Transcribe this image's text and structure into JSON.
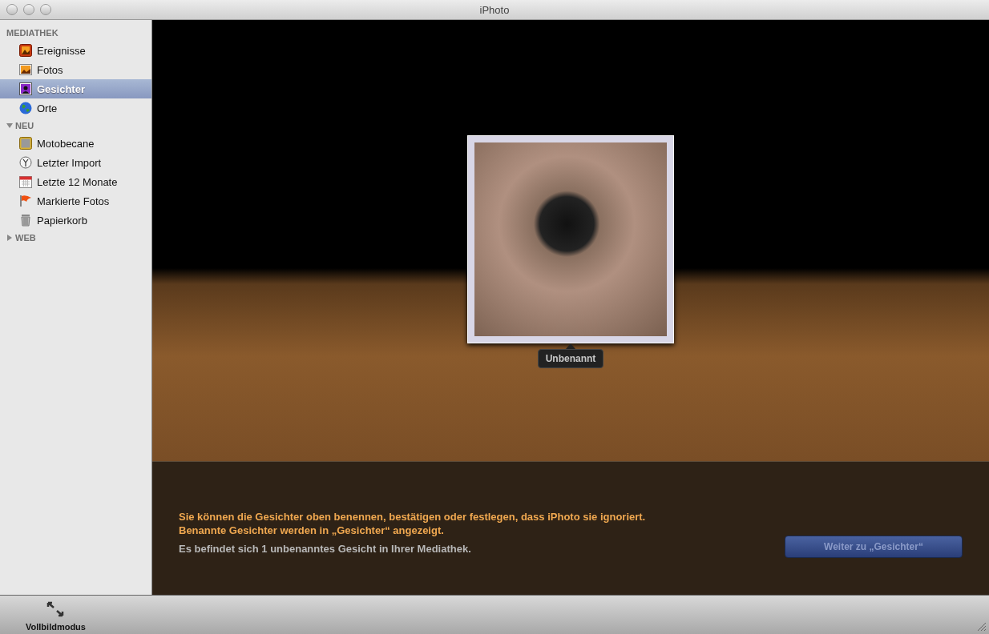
{
  "window": {
    "title": "iPhoto"
  },
  "sidebar": {
    "sections": [
      {
        "title": "MEDIATHEK",
        "items": [
          {
            "label": "Ereignisse",
            "kind": "events",
            "selected": false
          },
          {
            "label": "Fotos",
            "kind": "photos",
            "selected": false
          },
          {
            "label": "Gesichter",
            "kind": "faces",
            "selected": true
          },
          {
            "label": "Orte",
            "kind": "places",
            "selected": false
          }
        ]
      },
      {
        "title": "NEU",
        "expanded": true,
        "items": [
          {
            "label": "Motobecane",
            "kind": "album",
            "selected": false
          },
          {
            "label": "Letzter Import",
            "kind": "import",
            "selected": false
          },
          {
            "label": "Letzte 12 Monate",
            "kind": "calendar",
            "selected": false
          },
          {
            "label": "Markierte Fotos",
            "kind": "flag",
            "selected": false
          },
          {
            "label": "Papierkorb",
            "kind": "trash",
            "selected": false
          }
        ]
      },
      {
        "title": "WEB",
        "expanded": false
      }
    ]
  },
  "face": {
    "name": "Unbenannt"
  },
  "info": {
    "lines": [
      "Sie können die Gesichter oben benennen, bestätigen oder festlegen, dass iPhoto sie ignoriert.",
      "Benannte Gesichter werden in „Gesichter“ angezeigt."
    ],
    "count": "Es befindet sich 1 unbenanntes Gesicht in Ihrer Mediathek.",
    "button": "Weiter zu „Gesichter“"
  },
  "toolbar": {
    "fullscreen": "Vollbildmodus"
  }
}
